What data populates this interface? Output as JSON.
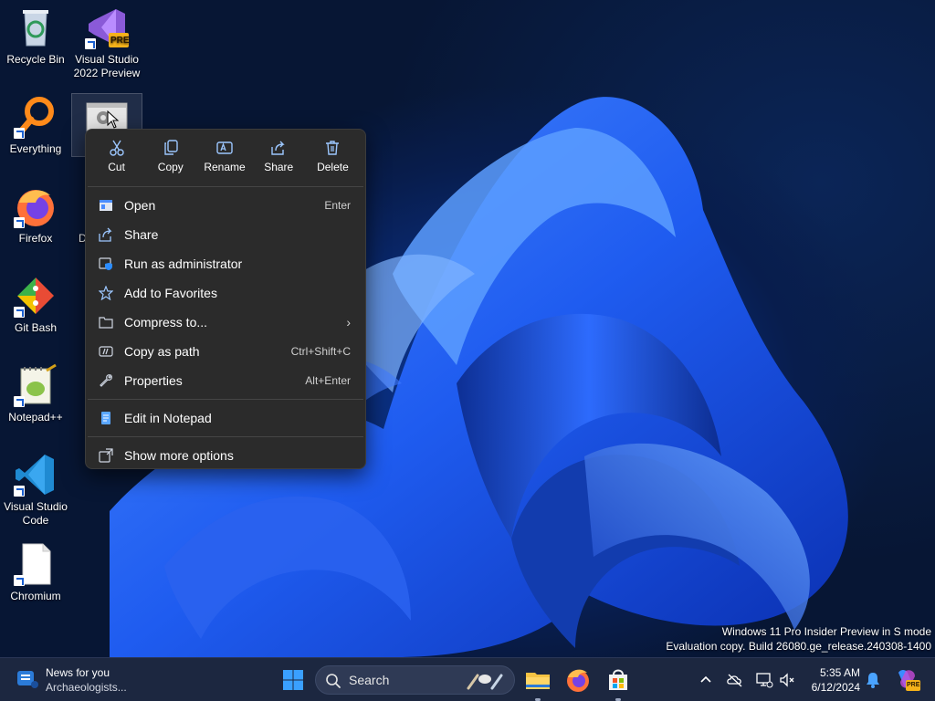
{
  "desktop": {
    "icons": [
      {
        "label": "Recycle Bin"
      },
      {
        "label": "Visual Studio 2022 Preview",
        "badge": "PRE"
      },
      {
        "label": "Everything"
      },
      {
        "label": "Firefox"
      },
      {
        "label": "Git Bash"
      },
      {
        "label": "Notepad++"
      },
      {
        "label": "Visual Studio Code"
      },
      {
        "label": "Chromium"
      }
    ],
    "partial_label": "D"
  },
  "context_menu": {
    "quick_actions": [
      {
        "label": "Cut",
        "icon": "scissors-icon"
      },
      {
        "label": "Copy",
        "icon": "copy-icon"
      },
      {
        "label": "Rename",
        "icon": "rename-icon"
      },
      {
        "label": "Share",
        "icon": "share-icon"
      },
      {
        "label": "Delete",
        "icon": "trash-icon"
      }
    ],
    "items": [
      {
        "label": "Open",
        "shortcut": "Enter",
        "icon": "open-icon"
      },
      {
        "label": "Share",
        "shortcut": "",
        "icon": "share-icon"
      },
      {
        "label": "Run as administrator",
        "shortcut": "",
        "icon": "shield-icon"
      },
      {
        "label": "Add to Favorites",
        "shortcut": "",
        "icon": "star-icon"
      },
      {
        "label": "Compress to...",
        "shortcut": "",
        "icon": "archive-icon",
        "submenu": true
      },
      {
        "label": "Copy as path",
        "shortcut": "Ctrl+Shift+C",
        "icon": "path-icon"
      },
      {
        "label": "Properties",
        "shortcut": "Alt+Enter",
        "icon": "wrench-icon"
      },
      {
        "label": "Edit in Notepad",
        "shortcut": "",
        "icon": "notepad-icon"
      },
      {
        "label": "Show more options",
        "shortcut": "",
        "icon": "more-options-icon"
      }
    ]
  },
  "watermark": {
    "line1": "Windows 11 Pro Insider Preview in S mode",
    "line2": "Evaluation copy. Build 26080.ge_release.240308-1400"
  },
  "taskbar": {
    "news": {
      "title": "News for you",
      "subtitle": "Archaeologists..."
    },
    "search_placeholder": "Search",
    "clock": {
      "time": "5:35 AM",
      "date": "6/12/2024"
    },
    "copilot_badge": "PRE"
  },
  "colors": {
    "accent": "#0078d4",
    "menu_bg": "#2b2b2b",
    "taskbar_bg": "#1c2740"
  }
}
